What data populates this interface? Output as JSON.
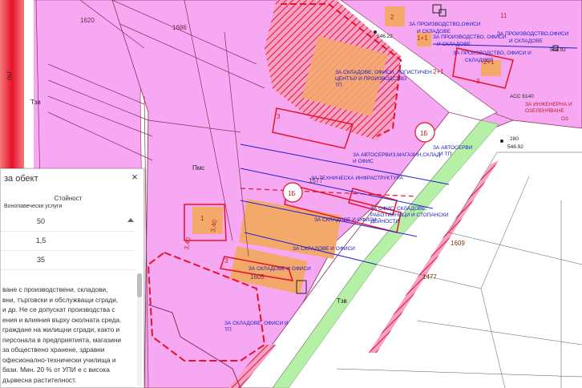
{
  "parcels": {
    "p1620": "1620",
    "p1686": "1686",
    "p1577": "1577",
    "p1605": "1605",
    "p1609": "1609",
    "p1477": "1477"
  },
  "streets": {
    "tzv_left": "Тзв",
    "pms": "Пмс",
    "tzv_bottom": "Тзв",
    "put": "пьт"
  },
  "zones": {
    "z1": "ЗА ПРОИЗВОДСТВО,ОФИСИ",
    "z1b": "И СКЛАДОВЕ",
    "z2": "ЗА ПРОИЗВОДСТВО, ОФИСИ",
    "z2b": "И СКЛАДОВЕ",
    "z3": "ЗА ПРОИЗВОДСТВО,ОФИСИ",
    "z3b": "И СКЛАДОВЕ",
    "z4": "ЗА ПРОИЗВОДСТВО, ОФИСИ И",
    "z4b": "СКЛАДОВЕ",
    "z5": "ЗА СКЛАДОВЕ, ОФИСИ, ЛОГИСТИЧЕН",
    "z5b": "ЦЕНТЪР И ПРОИЗВОДСТВО",
    "z5c": "ТП",
    "z6": "ЗА АВТОСЕРВИ",
    "z6b": "И ТП",
    "z7": "ЗА АВТОСЕРВИЗ,МАГАЗИН,СКЛАД",
    "z7b": "И ОФИС",
    "z8": "ЗА ТЕХНИЧЕСКА ИНФРАСТРУКТУРА",
    "z9": "ЗА СКЛАДОВЕ И ОФИСИ",
    "z10": "ЗА ОФИС, СКЛАДОВЕ,",
    "z10b": "РАБОТИЛНИЦИ И СТОПАНСКИ",
    "z10c": "ДЕЙНОСТИ",
    "z11": "ЗА СКЛАДОВЕ И ОФИСИ",
    "z12": "ЗА СКЛАДОВЕ И ОФИСИ",
    "z13": "ЗА СКЛАДОВЕ, ОФИСИ И",
    "z13b": "ТП",
    "z14": "ЗА ИНЖЕНЕРНА И",
    "z14b": "ОЗЕЛЕНЯВАНЕ",
    "z14c": "ОЗ"
  },
  "labels": {
    "ac": "АСС 6140",
    "num1": "546.22",
    "num2": "546.92",
    "num3": "546.92",
    "num_280": "280",
    "one_b_1": "1Б",
    "one_b_2": "1Б",
    "n3a": "3",
    "n3b": "3",
    "n2": "2",
    "n2p1a": "2+1",
    "n2p1b": "2+1",
    "n1p1": "1+1",
    "n11": "11",
    "n3c": "3",
    "n1": "1",
    "n3_40": "3,40",
    "n3_40b": "3,40"
  },
  "panel": {
    "title": "за обект",
    "close": "×",
    "column_header": "Стойност",
    "first_row": "Вонопавечески услуги",
    "rows": [
      "50",
      "1,5",
      "35"
    ],
    "description": [
      "ване с производствени, складови,",
      "вни, търговски и обслужващи сгради,",
      "и др. Не се допускат производства с",
      "ения и влияния върху околната среда.",
      "граждане на жилищни сгради, както и",
      "персонала в предприятията, магазини",
      " за обществено хранене, здравни",
      "офесионално-технически училища и",
      "бази. Мин. 20 % от УПИ е с висока",
      "дървесна растителност."
    ]
  },
  "colors": {
    "zone_fill": "#f7a8f2",
    "zone_fill_alt": "#f08ee8",
    "building_fill": "#f3a96a",
    "red_line": "#e8102a",
    "blue_line": "#1f1fd6",
    "green_strip": "#b6f0a6",
    "road_white": "#ffffff",
    "boundary": "#8a2e5a"
  }
}
